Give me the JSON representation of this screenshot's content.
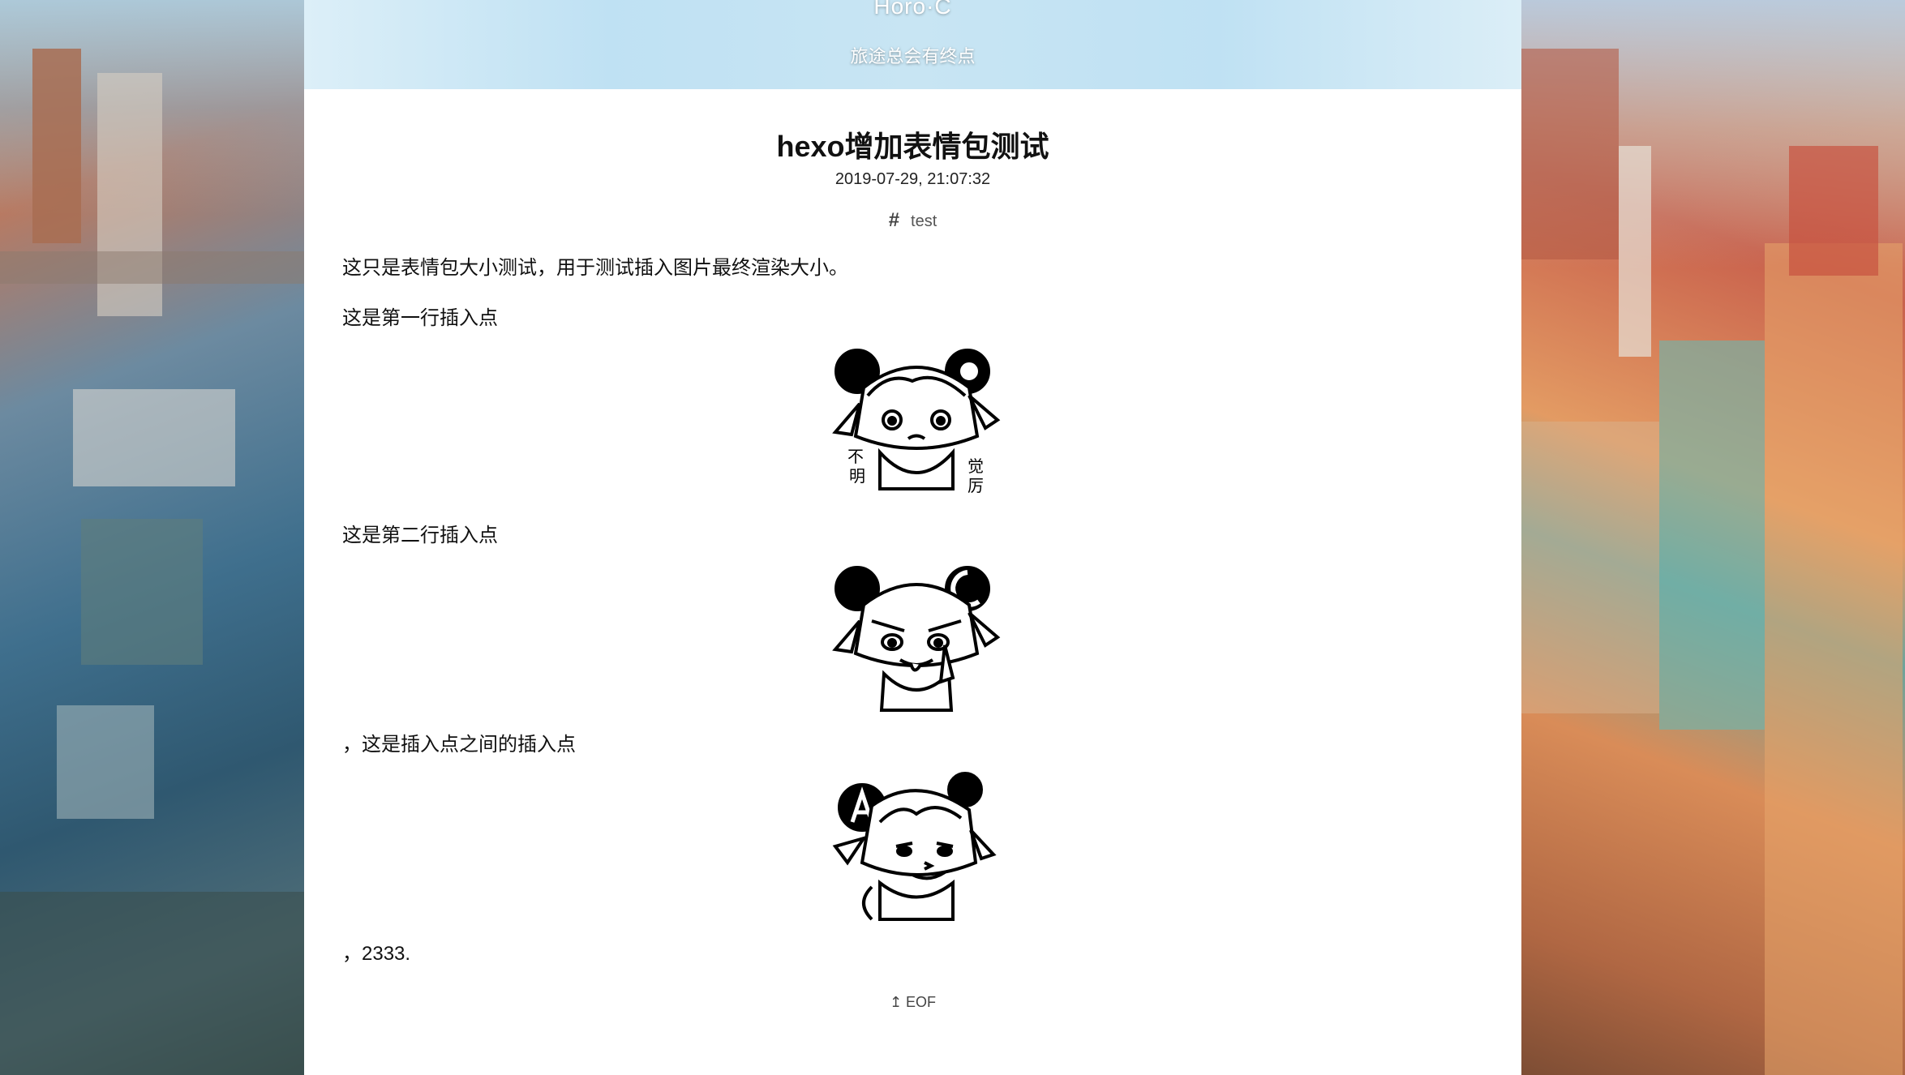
{
  "header": {
    "site_title": "Horo·C",
    "site_subtitle": "旅途总会有终点"
  },
  "post": {
    "title": "hexo增加表情包测试",
    "date": "2019-07-29, 21:07:32",
    "tag_icon": "hash-icon",
    "tag": "test",
    "paragraphs": [
      "这只是表情包大小测试，用于测试插入图片最终渲染大小。",
      "这是第一行插入点",
      "这是第二行插入点",
      "，这是插入点之间的插入点",
      "，2333."
    ],
    "sticker_1_text": [
      "不",
      "明",
      "觉",
      "厉"
    ],
    "eof": "↥ EOF"
  },
  "colors": {
    "header_gradient": "#bfe1f3",
    "panel_bg": "#ffffff",
    "text": "#111111"
  }
}
